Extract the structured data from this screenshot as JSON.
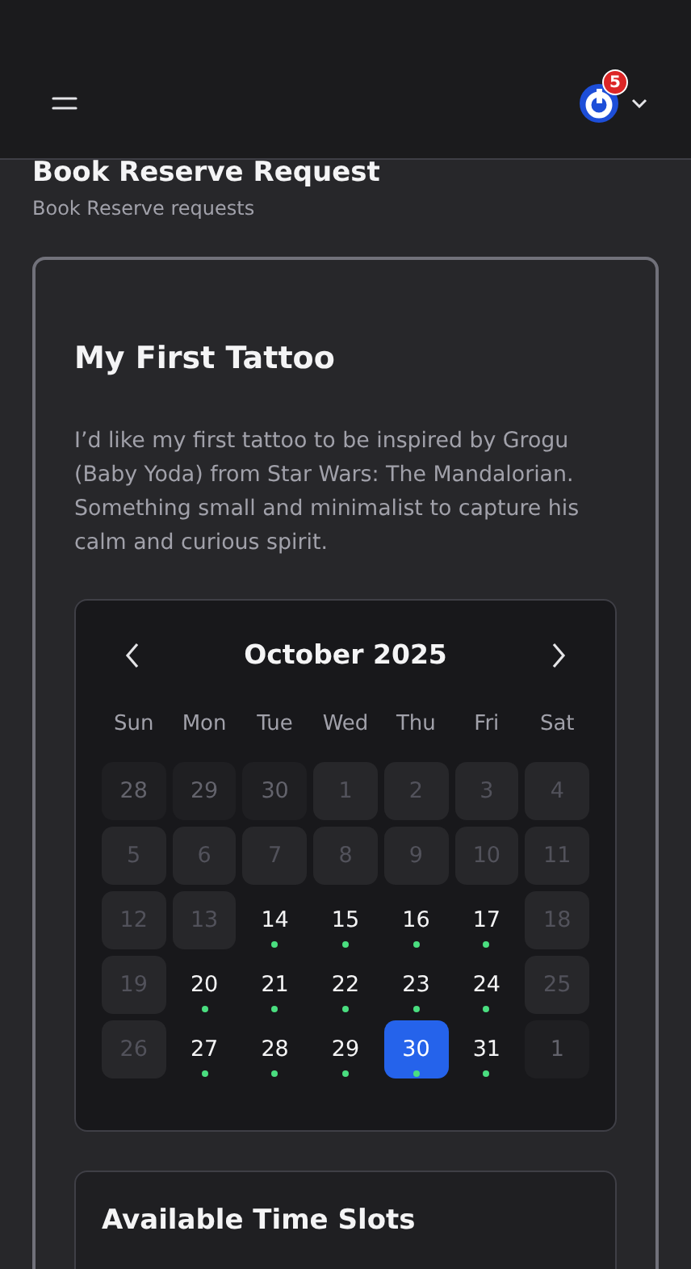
{
  "header": {
    "notification_count": "5"
  },
  "page": {
    "title": "Book Reserve Request",
    "subtitle": "Book Reserve requests"
  },
  "request": {
    "title": "My First Tattoo",
    "description": "I’d like my first tattoo to be inspired by Grogu (Baby Yoda) from Star Wars: The Mandalorian. Something small and minimalist to capture his calm and curious spirit."
  },
  "calendar": {
    "month": "October 2025",
    "weekdays": [
      "Sun",
      "Mon",
      "Tue",
      "Wed",
      "Thu",
      "Fri",
      "Sat"
    ],
    "days": [
      {
        "label": "28",
        "kind": "outside",
        "selected": false
      },
      {
        "label": "29",
        "kind": "outside",
        "selected": false
      },
      {
        "label": "30",
        "kind": "outside",
        "selected": false
      },
      {
        "label": "1",
        "kind": "disabled",
        "selected": false
      },
      {
        "label": "2",
        "kind": "disabled",
        "selected": false
      },
      {
        "label": "3",
        "kind": "disabled",
        "selected": false
      },
      {
        "label": "4",
        "kind": "disabled",
        "selected": false
      },
      {
        "label": "5",
        "kind": "disabled",
        "selected": false
      },
      {
        "label": "6",
        "kind": "disabled",
        "selected": false
      },
      {
        "label": "7",
        "kind": "disabled",
        "selected": false
      },
      {
        "label": "8",
        "kind": "disabled",
        "selected": false
      },
      {
        "label": "9",
        "kind": "disabled",
        "selected": false
      },
      {
        "label": "10",
        "kind": "disabled",
        "selected": false
      },
      {
        "label": "11",
        "kind": "disabled",
        "selected": false
      },
      {
        "label": "12",
        "kind": "disabled",
        "selected": false
      },
      {
        "label": "13",
        "kind": "disabled",
        "selected": false
      },
      {
        "label": "14",
        "kind": "available",
        "selected": false
      },
      {
        "label": "15",
        "kind": "available",
        "selected": false
      },
      {
        "label": "16",
        "kind": "available",
        "selected": false
      },
      {
        "label": "17",
        "kind": "available",
        "selected": false
      },
      {
        "label": "18",
        "kind": "disabled",
        "selected": false
      },
      {
        "label": "19",
        "kind": "disabled",
        "selected": false
      },
      {
        "label": "20",
        "kind": "available",
        "selected": false
      },
      {
        "label": "21",
        "kind": "available",
        "selected": false
      },
      {
        "label": "22",
        "kind": "available",
        "selected": false
      },
      {
        "label": "23",
        "kind": "available",
        "selected": false
      },
      {
        "label": "24",
        "kind": "available",
        "selected": false
      },
      {
        "label": "25",
        "kind": "disabled",
        "selected": false
      },
      {
        "label": "26",
        "kind": "disabled",
        "selected": false
      },
      {
        "label": "27",
        "kind": "available",
        "selected": false
      },
      {
        "label": "28",
        "kind": "available",
        "selected": false
      },
      {
        "label": "29",
        "kind": "available",
        "selected": false
      },
      {
        "label": "30",
        "kind": "available",
        "selected": true
      },
      {
        "label": "31",
        "kind": "available",
        "selected": false
      },
      {
        "label": "1",
        "kind": "outside",
        "selected": false
      }
    ]
  },
  "time_slots": {
    "title": "Available Time Slots"
  }
}
